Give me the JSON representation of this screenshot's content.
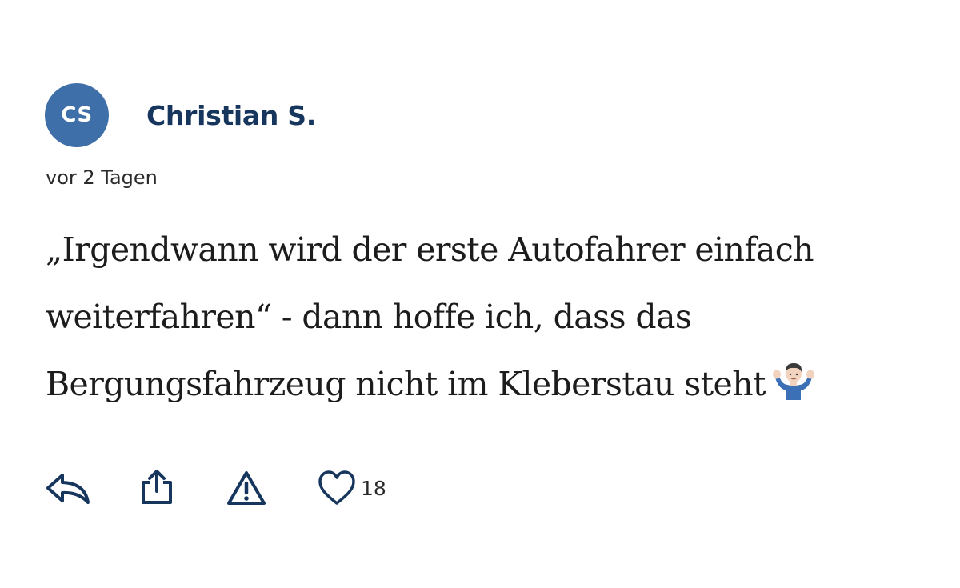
{
  "comment": {
    "author": {
      "initials": "CS",
      "name": "Christian S."
    },
    "timestamp": "vor 2 Tagen",
    "text": "„Irgendwann wird der erste Autofahrer einfach weiterfahren“ - dann hoffe ich, dass das Bergungsfahrzeug nicht im Kleberstau steht",
    "emoji": "person-shrugging-emoji",
    "actions": {
      "reply_icon": "reply-arrow-icon",
      "share_icon": "share-upload-icon",
      "report_icon": "warning-triangle-icon",
      "like_icon": "heart-outline-icon",
      "like_count": "18"
    }
  },
  "colors": {
    "avatar_background": "#3f6fa8",
    "author_name": "#17365d",
    "icon_color": "#17365d",
    "body_text": "#1c1c1c"
  }
}
